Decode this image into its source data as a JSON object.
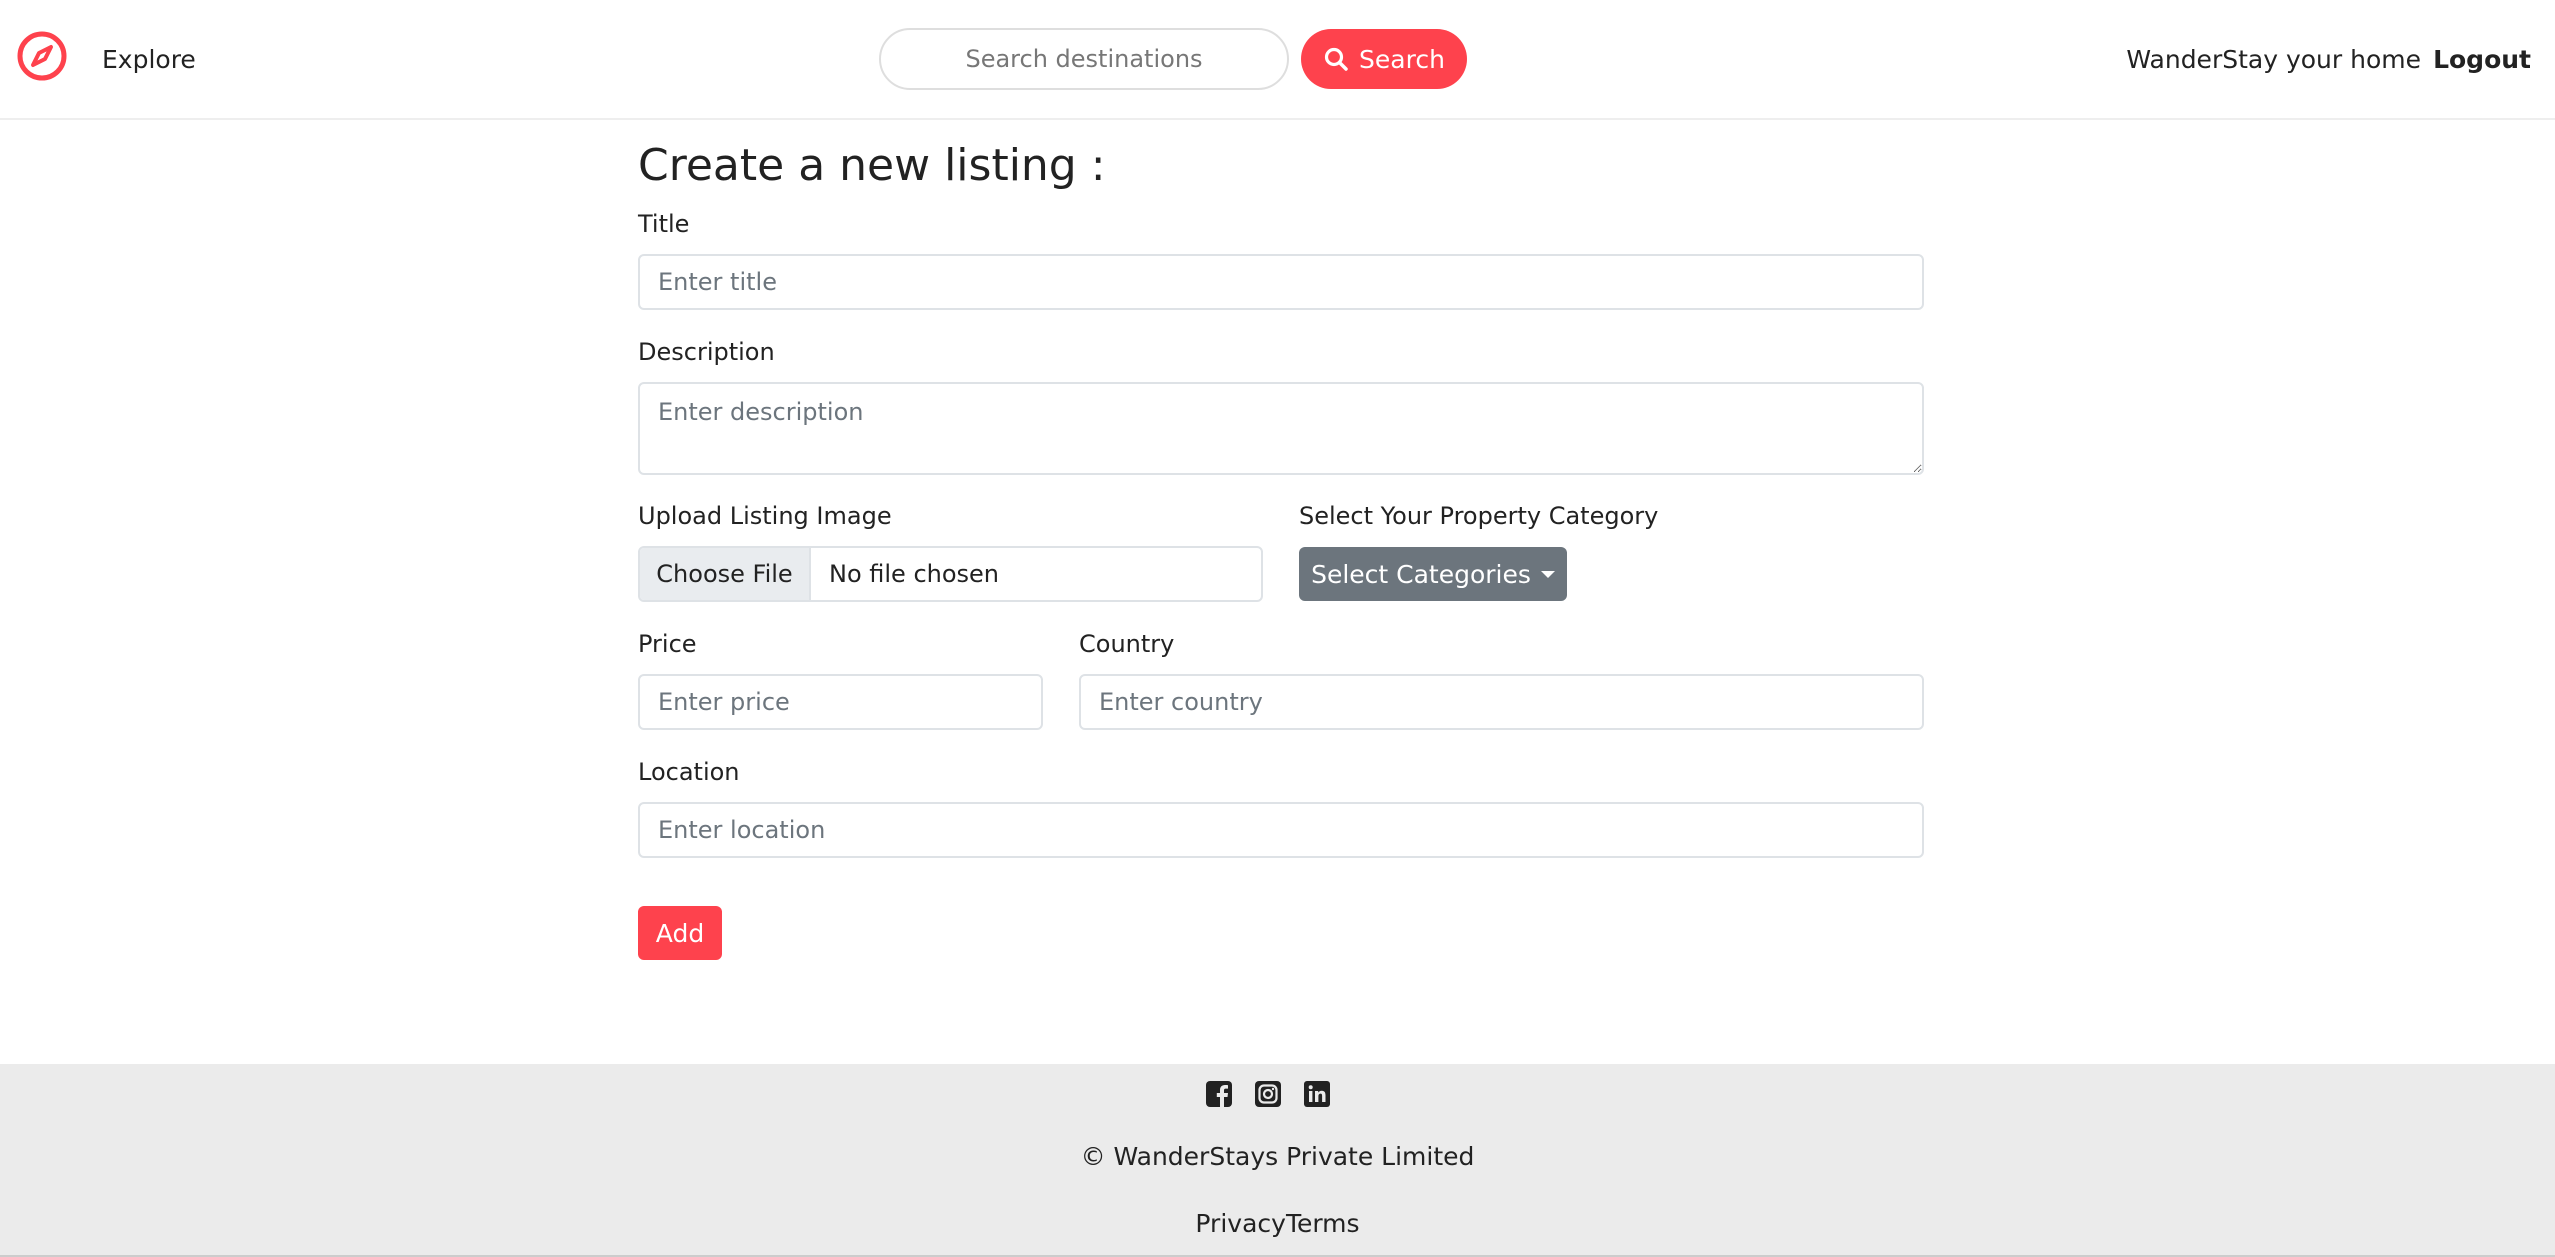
{
  "navbar": {
    "logo_icon": "compass-icon",
    "explore": "Explore",
    "search_placeholder": "Search destinations",
    "search_button": "Search",
    "home_link": "WanderStay your home",
    "logout": "Logout"
  },
  "form": {
    "heading": "Create a new listing :",
    "title_label": "Title",
    "title_placeholder": "Enter title",
    "description_label": "Description",
    "description_placeholder": "Enter description",
    "image_label": "Upload Listing Image",
    "file_button": "Choose File",
    "file_status": "No file chosen",
    "category_label": "Select Your Property Category",
    "category_button": "Select Categories",
    "price_label": "Price",
    "price_placeholder": "Enter price",
    "country_label": "Country",
    "country_placeholder": "Enter country",
    "location_label": "Location",
    "location_placeholder": "Enter location",
    "submit": "Add"
  },
  "footer": {
    "socials": [
      "facebook-icon",
      "instagram-icon",
      "linkedin-icon"
    ],
    "copyright": "© WanderStays Private Limited",
    "privacy": "Privacy",
    "terms": "Terms"
  },
  "colors": {
    "accent": "#fe424d",
    "secondary": "#6c757d",
    "footer_bg": "#ebebeb"
  }
}
